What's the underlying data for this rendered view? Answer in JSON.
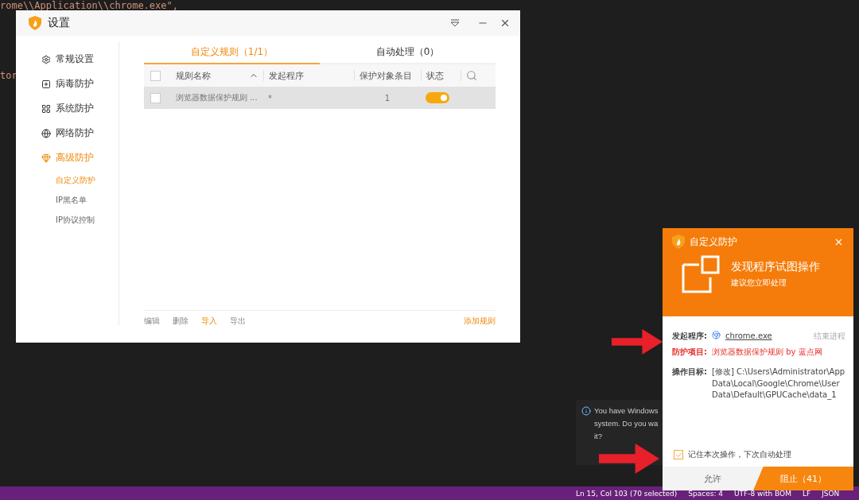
{
  "editor": {
    "code_lines": [
      {
        "text": "rome\\\\Application\\\\chrome.exe\","
      },
      {
        "text": "tor"
      }
    ]
  },
  "settings_window": {
    "title": "设置",
    "sidebar": {
      "items": [
        {
          "label": "常规设置",
          "selected": false
        },
        {
          "label": "病毒防护",
          "selected": false
        },
        {
          "label": "系统防护",
          "selected": false
        },
        {
          "label": "网络防护",
          "selected": false
        },
        {
          "label": "高级防护",
          "selected": true,
          "children": [
            {
              "label": "自定义防护",
              "selected": true
            },
            {
              "label": "IP黑名单",
              "selected": false
            },
            {
              "label": "IP协议控制",
              "selected": false
            }
          ]
        }
      ]
    },
    "tabs": [
      {
        "label": "自定义规则（1/1）",
        "selected": true
      },
      {
        "label": "自动处理（0）",
        "selected": false
      }
    ],
    "table": {
      "select_all_checked": false,
      "columns": [
        {
          "label": "规则名称",
          "sorted": true
        },
        {
          "label": "发起程序",
          "sorted": false
        },
        {
          "label": "保护对象条目",
          "sorted": false
        },
        {
          "label": "状态",
          "sorted": false
        }
      ],
      "rows": [
        {
          "name": "浏览器数据保护规则 ...",
          "program": "*",
          "count": "1",
          "on": true,
          "checked": false,
          "selected": true
        }
      ]
    },
    "footer_actions": [
      {
        "label": "编辑",
        "highlighted": false
      },
      {
        "label": "删除",
        "highlighted": false
      },
      {
        "label": "导入",
        "highlighted": true
      },
      {
        "label": "导出",
        "highlighted": false
      }
    ],
    "add_rule": "添加规则"
  },
  "toast": {
    "lines": [
      "You have Windows",
      "system. Do you wa",
      "it?"
    ]
  },
  "popup": {
    "title": "自定义防护",
    "headline": "发现程序试图操作",
    "subline": "建议您立即处理",
    "details": [
      {
        "kind": "program",
        "label": "发起程序:",
        "value": "chrome.exe",
        "action": "结束进程"
      },
      {
        "kind": "alert",
        "label": "防护项目:",
        "value": "浏览器数据保护规则 by 蓝点网"
      },
      {
        "kind": "plain",
        "label": "操作目标:",
        "value": "[修改] C:\\Users\\Administrator\\AppData\\Local\\Google\\Chrome\\User Data\\Default\\GPUCache\\data_1"
      }
    ],
    "remember": {
      "label": "记住本次操作，下次自动处理",
      "checked": true
    },
    "buttons": [
      {
        "label": "允许",
        "kind": "secondary"
      },
      {
        "label": "阻止（41）",
        "kind": "primary"
      }
    ]
  },
  "status_bar": {
    "items": [
      "Ln 15, Col 103 (70 selected)",
      "Spaces: 4",
      "UTF-8 with BOM",
      "LF",
      "JSON"
    ]
  }
}
